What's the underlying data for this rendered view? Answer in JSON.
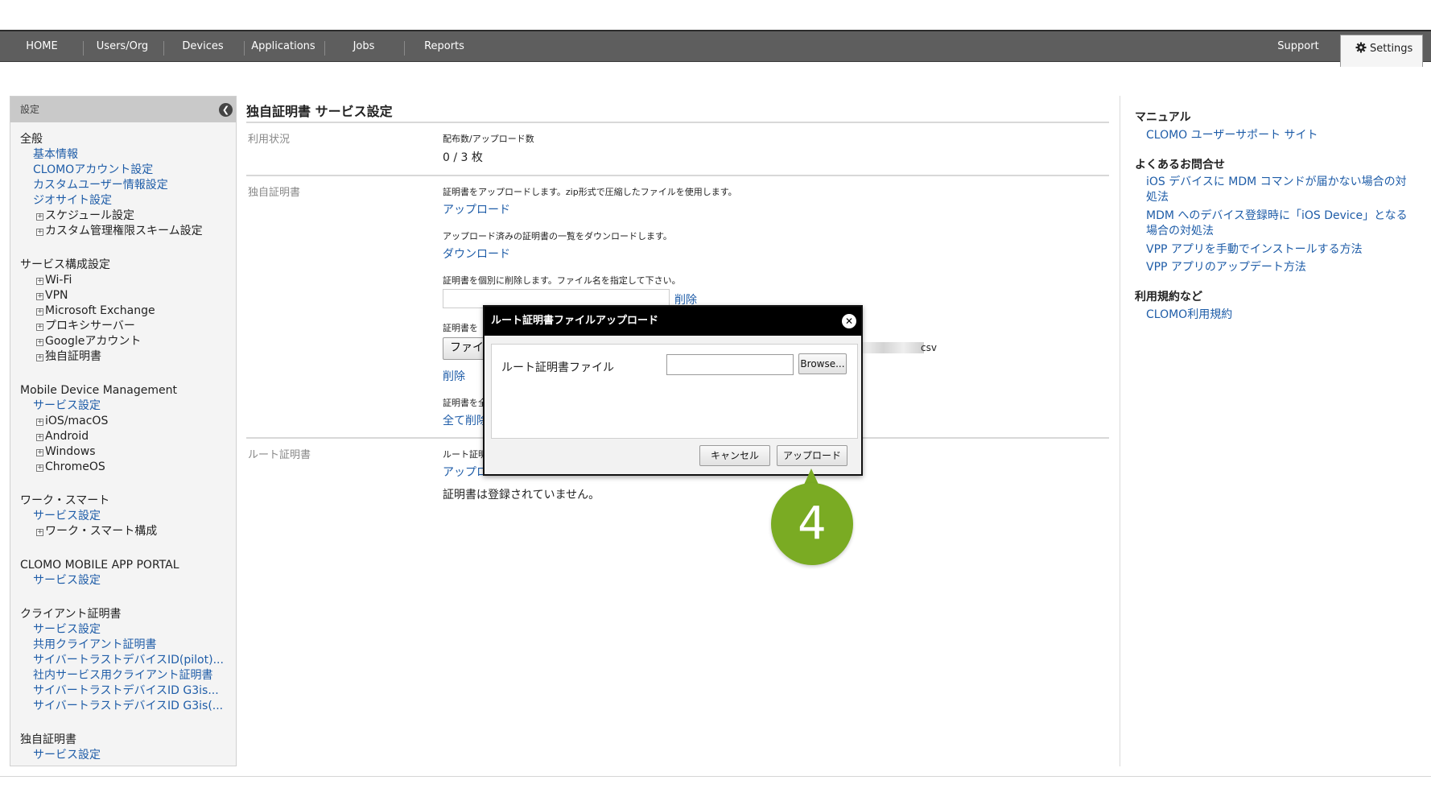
{
  "nav": {
    "items": [
      "HOME",
      "Users/Org",
      "Devices",
      "Applications",
      "Jobs",
      "Reports"
    ],
    "support": "Support",
    "settings": "Settings"
  },
  "sidebar": {
    "header": "設定",
    "sections": {
      "general": {
        "title": "全般",
        "links": [
          "基本情報",
          "CLOMOアカウント設定",
          "カスタムユーザー情報設定",
          "ジオサイト設定"
        ],
        "tree": [
          "スケジュール設定",
          "カスタム管理権限スキーム設定"
        ]
      },
      "service": {
        "title": "サービス構成設定",
        "tree": [
          "Wi-Fi",
          "VPN",
          "Microsoft Exchange",
          "プロキシサーバー",
          "Googleアカウント",
          "独自証明書"
        ]
      },
      "mdm": {
        "title": "Mobile Device Management",
        "links": [
          "サービス設定"
        ],
        "tree": [
          "iOS/macOS",
          "Android",
          "Windows",
          "ChromeOS"
        ]
      },
      "work": {
        "title": "ワーク・スマート",
        "links": [
          "サービス設定"
        ],
        "tree": [
          "ワーク・スマート構成"
        ]
      },
      "portal": {
        "title": "CLOMO MOBILE APP PORTAL",
        "links": [
          "サービス設定"
        ]
      },
      "client": {
        "title": "クライアント証明書",
        "links": [
          "サービス設定",
          "共用クライアント証明書",
          "サイバートラストデバイスID(pilot)...",
          "社内サービス用クライアント証明書",
          "サイバートラストデバイスID G3is...",
          "サイバートラストデバイスID G3is(..."
        ]
      },
      "own": {
        "title": "独自証明書",
        "links": [
          "サービス設定"
        ]
      }
    }
  },
  "main": {
    "title": "独自証明書 サービス設定",
    "usage": {
      "label": "利用状況",
      "caption": "配布数/アップロード数",
      "value": "0 / 3 枚"
    },
    "own_cert": {
      "label": "独自証明書",
      "upload_desc": "証明書をアップロードします。zip形式で圧縮したファイルを使用します。",
      "upload_link": "アップロード",
      "download_desc": "アップロード済みの証明書の一覧をダウンロードします。",
      "download_link": "ダウンロード",
      "delete_desc": "証明書を個別に削除します。ファイル名を指定して下さい。",
      "delete_link": "削除",
      "file_desc_partial": "証明書を",
      "file_button_partial": "ファイ",
      "file_suffix": "csv",
      "delete_link2": "削除",
      "delete_all_desc_partial": "証明書を全",
      "delete_all_link_partial": "全て削除"
    },
    "root_cert": {
      "label": "ルート証明書",
      "desc_partial": "ルート証明",
      "upload_link_partial": "アップロ",
      "none_text": "証明書は登録されていません。"
    }
  },
  "right": {
    "manual_title": "マニュアル",
    "manual_link": "CLOMO ユーザーサポート サイト",
    "faq_title": "よくあるお問合せ",
    "faq_links": [
      "iOS デバイスに MDM コマンドが届かない場合の対処法",
      "MDM へのデバイス登録時に「iOS Device」となる場合の対処法",
      "VPP アプリを手動でインストールする方法",
      "VPP アプリのアップデート方法"
    ],
    "terms_title": "利用規約など",
    "terms_link": "CLOMO利用規約"
  },
  "modal": {
    "title": "ルート証明書ファイルアップロード",
    "field_label": "ルート証明書ファイル",
    "browse": "Browse...",
    "cancel": "キャンセル",
    "upload": "アップロード"
  },
  "step_badge": "4",
  "colors": {
    "nav_bg": "#5e5e5e",
    "link": "#1f5da8",
    "badge": "#7aab23"
  }
}
